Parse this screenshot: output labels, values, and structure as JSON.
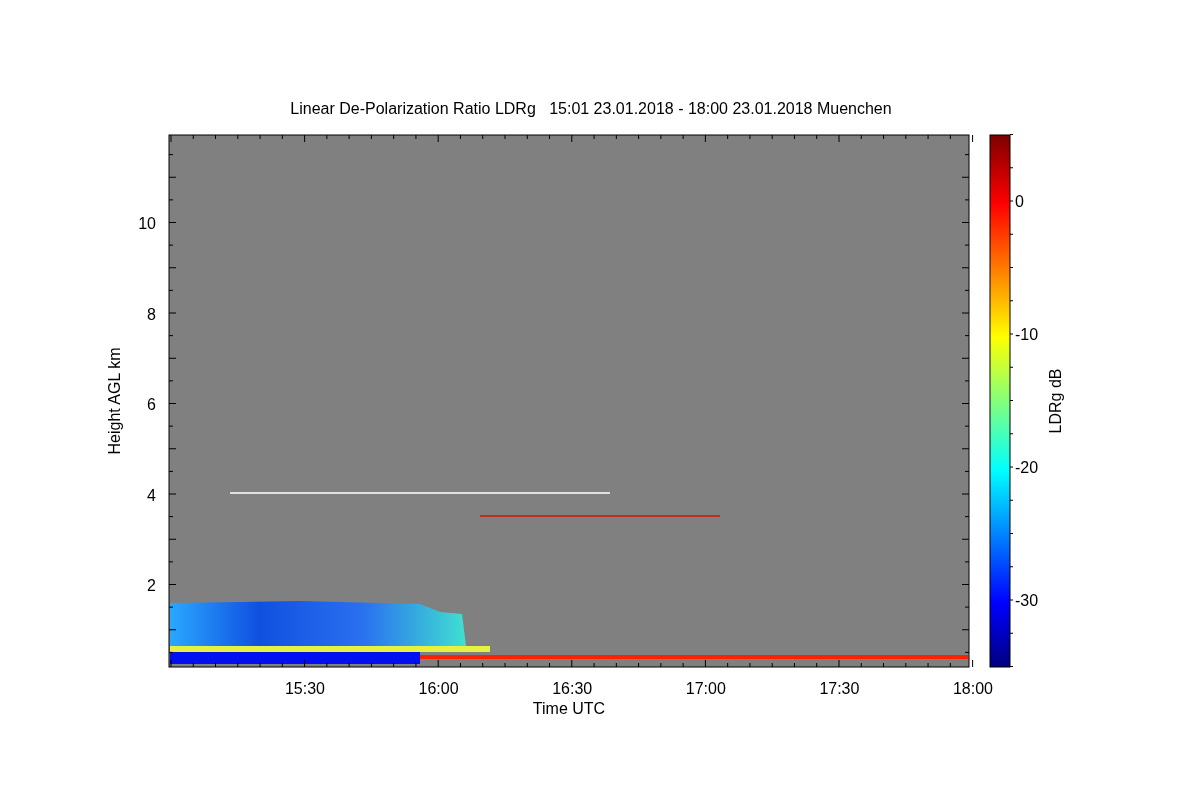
{
  "title": "Linear De-Polarization Ratio LDRg   15:01 23.01.2018 - 18:00 23.01.2018 Muenchen",
  "x_axis": {
    "label": "Time UTC",
    "ticks": [
      "15:30",
      "16:00",
      "16:30",
      "17:00",
      "17:30",
      "18:00"
    ]
  },
  "y_axis": {
    "label": "Height AGL km",
    "ticks": [
      "10",
      "8",
      "6",
      "4",
      "2"
    ]
  },
  "colorbar": {
    "label": "LDRg dB",
    "ticks": [
      "0",
      "-10",
      "-20",
      "-30"
    ]
  }
}
